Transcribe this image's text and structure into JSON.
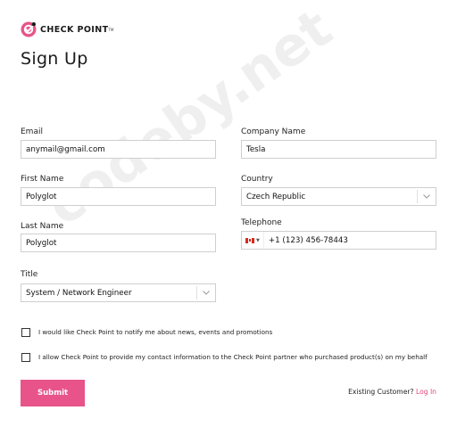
{
  "brand": {
    "name": "CHECK POINT",
    "accent": "#e8548a",
    "link_color": "#e0457b"
  },
  "page_title": "Sign Up",
  "form": {
    "email": {
      "label": "Email",
      "value": "anymail@gmail.com"
    },
    "first_name": {
      "label": "First Name",
      "value": "Polyglot"
    },
    "last_name": {
      "label": "Last Name",
      "value": "Polyglot"
    },
    "title": {
      "label": "Title",
      "value": "System / Network Engineer",
      "icon": "chevron-down-icon"
    },
    "company": {
      "label": "Company Name",
      "value": "Tesla"
    },
    "country": {
      "label": "Country",
      "value": "Czech Republic",
      "icon": "chevron-down-icon"
    },
    "telephone": {
      "label": "Telephone",
      "value": "+1 (123) 456-78443",
      "flag": "canada-flag-icon"
    }
  },
  "consents": [
    {
      "text": "I would like Check Point to notify me about news, events and promotions",
      "checked": false
    },
    {
      "text": "I allow Check Point to provide my contact information to the Check Point partner who purchased product(s) on my behalf",
      "checked": false
    }
  ],
  "submit_label": "Submit",
  "existing_customer": {
    "text": "Existing Customer?",
    "link": "Log In"
  },
  "watermark": "codeby.net"
}
